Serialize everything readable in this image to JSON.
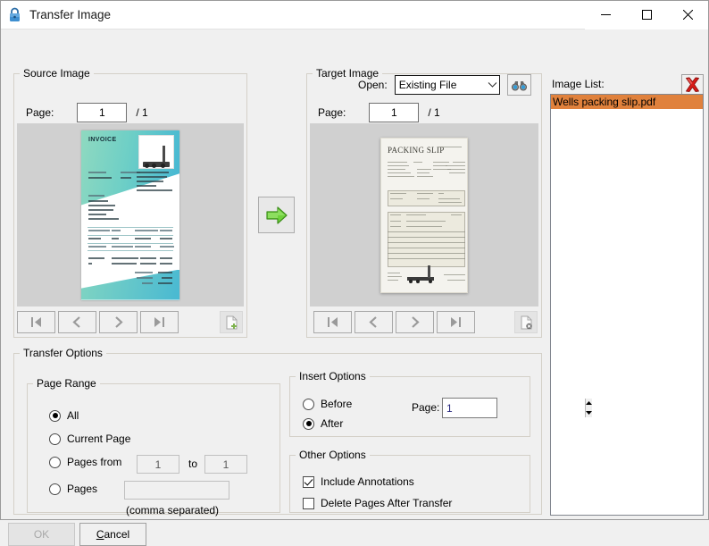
{
  "window": {
    "title": "Transfer Image",
    "lock_icon": "lock-icon",
    "minimize": "minimize-icon",
    "maximize": "maximize-icon",
    "close": "close-icon"
  },
  "source": {
    "legend": "Source Image",
    "page_label": "Page:",
    "page_value": "1",
    "page_total": "/ 1",
    "nav": {
      "first": "first-page-icon",
      "prev": "previous-page-icon",
      "next": "next-page-icon",
      "last": "last-page-icon",
      "extra": "add-page-icon"
    },
    "document": {
      "title": "INVOICE",
      "fields": [
        "DATE",
        "INVOICE NO",
        "BILLED TO"
      ],
      "table_headers": [
        "SALESPERSON",
        "JOB",
        "PAYMENT TERMS",
        "DUE DATE",
        "QUANTITY",
        "DESCRIPTION",
        "UNIT PRICE",
        "LINE TOTAL"
      ],
      "totals": [
        "SUBTOTAL",
        "SALES TAX",
        "TOTAL"
      ]
    }
  },
  "transfer_button": "transfer-right-arrow-icon",
  "target": {
    "legend": "Target Image",
    "open_label": "Open:",
    "open_value": "Existing File",
    "open_options": [
      "Existing File"
    ],
    "browse_icon": "binoculars-icon",
    "page_label": "Page:",
    "page_value": "1",
    "page_total": "/ 1",
    "nav": {
      "first": "first-page-icon",
      "prev": "previous-page-icon",
      "next": "next-page-icon",
      "last": "last-page-icon",
      "extra": "delete-page-icon"
    },
    "document": {
      "title": "PACKING SLIP"
    }
  },
  "image_list": {
    "label": "Image List:",
    "clear_icon": "red-x-delete-icon",
    "items": [
      {
        "name": "Wells packing slip.pdf",
        "selected": true
      }
    ],
    "selected_bg": "#e0813c"
  },
  "transfer_options": {
    "legend": "Transfer Options",
    "page_range": {
      "legend": "Page Range",
      "options": [
        {
          "label": "All",
          "checked": true
        },
        {
          "label": "Current Page",
          "checked": false
        },
        {
          "label": "Pages from",
          "checked": false
        },
        {
          "label": "Pages",
          "checked": false
        }
      ],
      "from_value": "1",
      "to_label": "to",
      "to_value": "1",
      "pages_value": "",
      "hint": "(comma separated)"
    },
    "insert_options": {
      "legend": "Insert Options",
      "options": [
        {
          "label": "Before",
          "checked": false
        },
        {
          "label": "After",
          "checked": true
        }
      ],
      "page_label": "Page:",
      "page_value": "1"
    },
    "other_options": {
      "legend": "Other Options",
      "checkboxes": [
        {
          "label": "Include Annotations",
          "checked": true
        },
        {
          "label": "Delete Pages After Transfer",
          "checked": false
        }
      ]
    }
  },
  "footer": {
    "ok_label": "OK",
    "ok_enabled": false,
    "cancel_prefix": "C",
    "cancel_rest": "ancel"
  }
}
